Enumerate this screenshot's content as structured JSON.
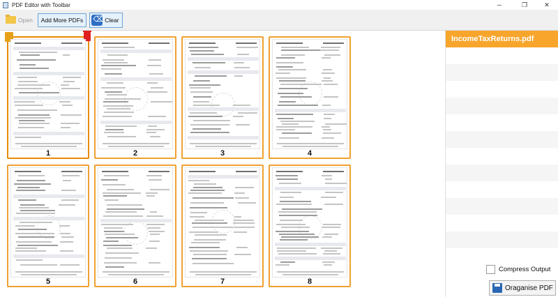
{
  "window": {
    "title": "PDF Editor with Toolbar",
    "controls": [
      "minimize-icon",
      "restore-icon",
      "close-icon"
    ]
  },
  "toolbar": {
    "open_label": "Open",
    "add_label": "Add More PDFs",
    "clear_label": "Clear"
  },
  "pages": [
    {
      "number": "1",
      "selected": true
    },
    {
      "number": "2",
      "selected": false
    },
    {
      "number": "3",
      "selected": false
    },
    {
      "number": "4",
      "selected": false
    },
    {
      "number": "5",
      "selected": false
    },
    {
      "number": "6",
      "selected": false
    },
    {
      "number": "7",
      "selected": false
    },
    {
      "number": "8",
      "selected": false
    }
  ],
  "sidebar": {
    "files": [
      "IncomeTaxReturns.pdf"
    ],
    "compress_label": "Compress Output",
    "compress_checked": false,
    "organise_label": "Oraganise PDF"
  },
  "colors": {
    "accent": "#f8a52c",
    "card_border": "#f0a030",
    "delete": "#e02020"
  }
}
